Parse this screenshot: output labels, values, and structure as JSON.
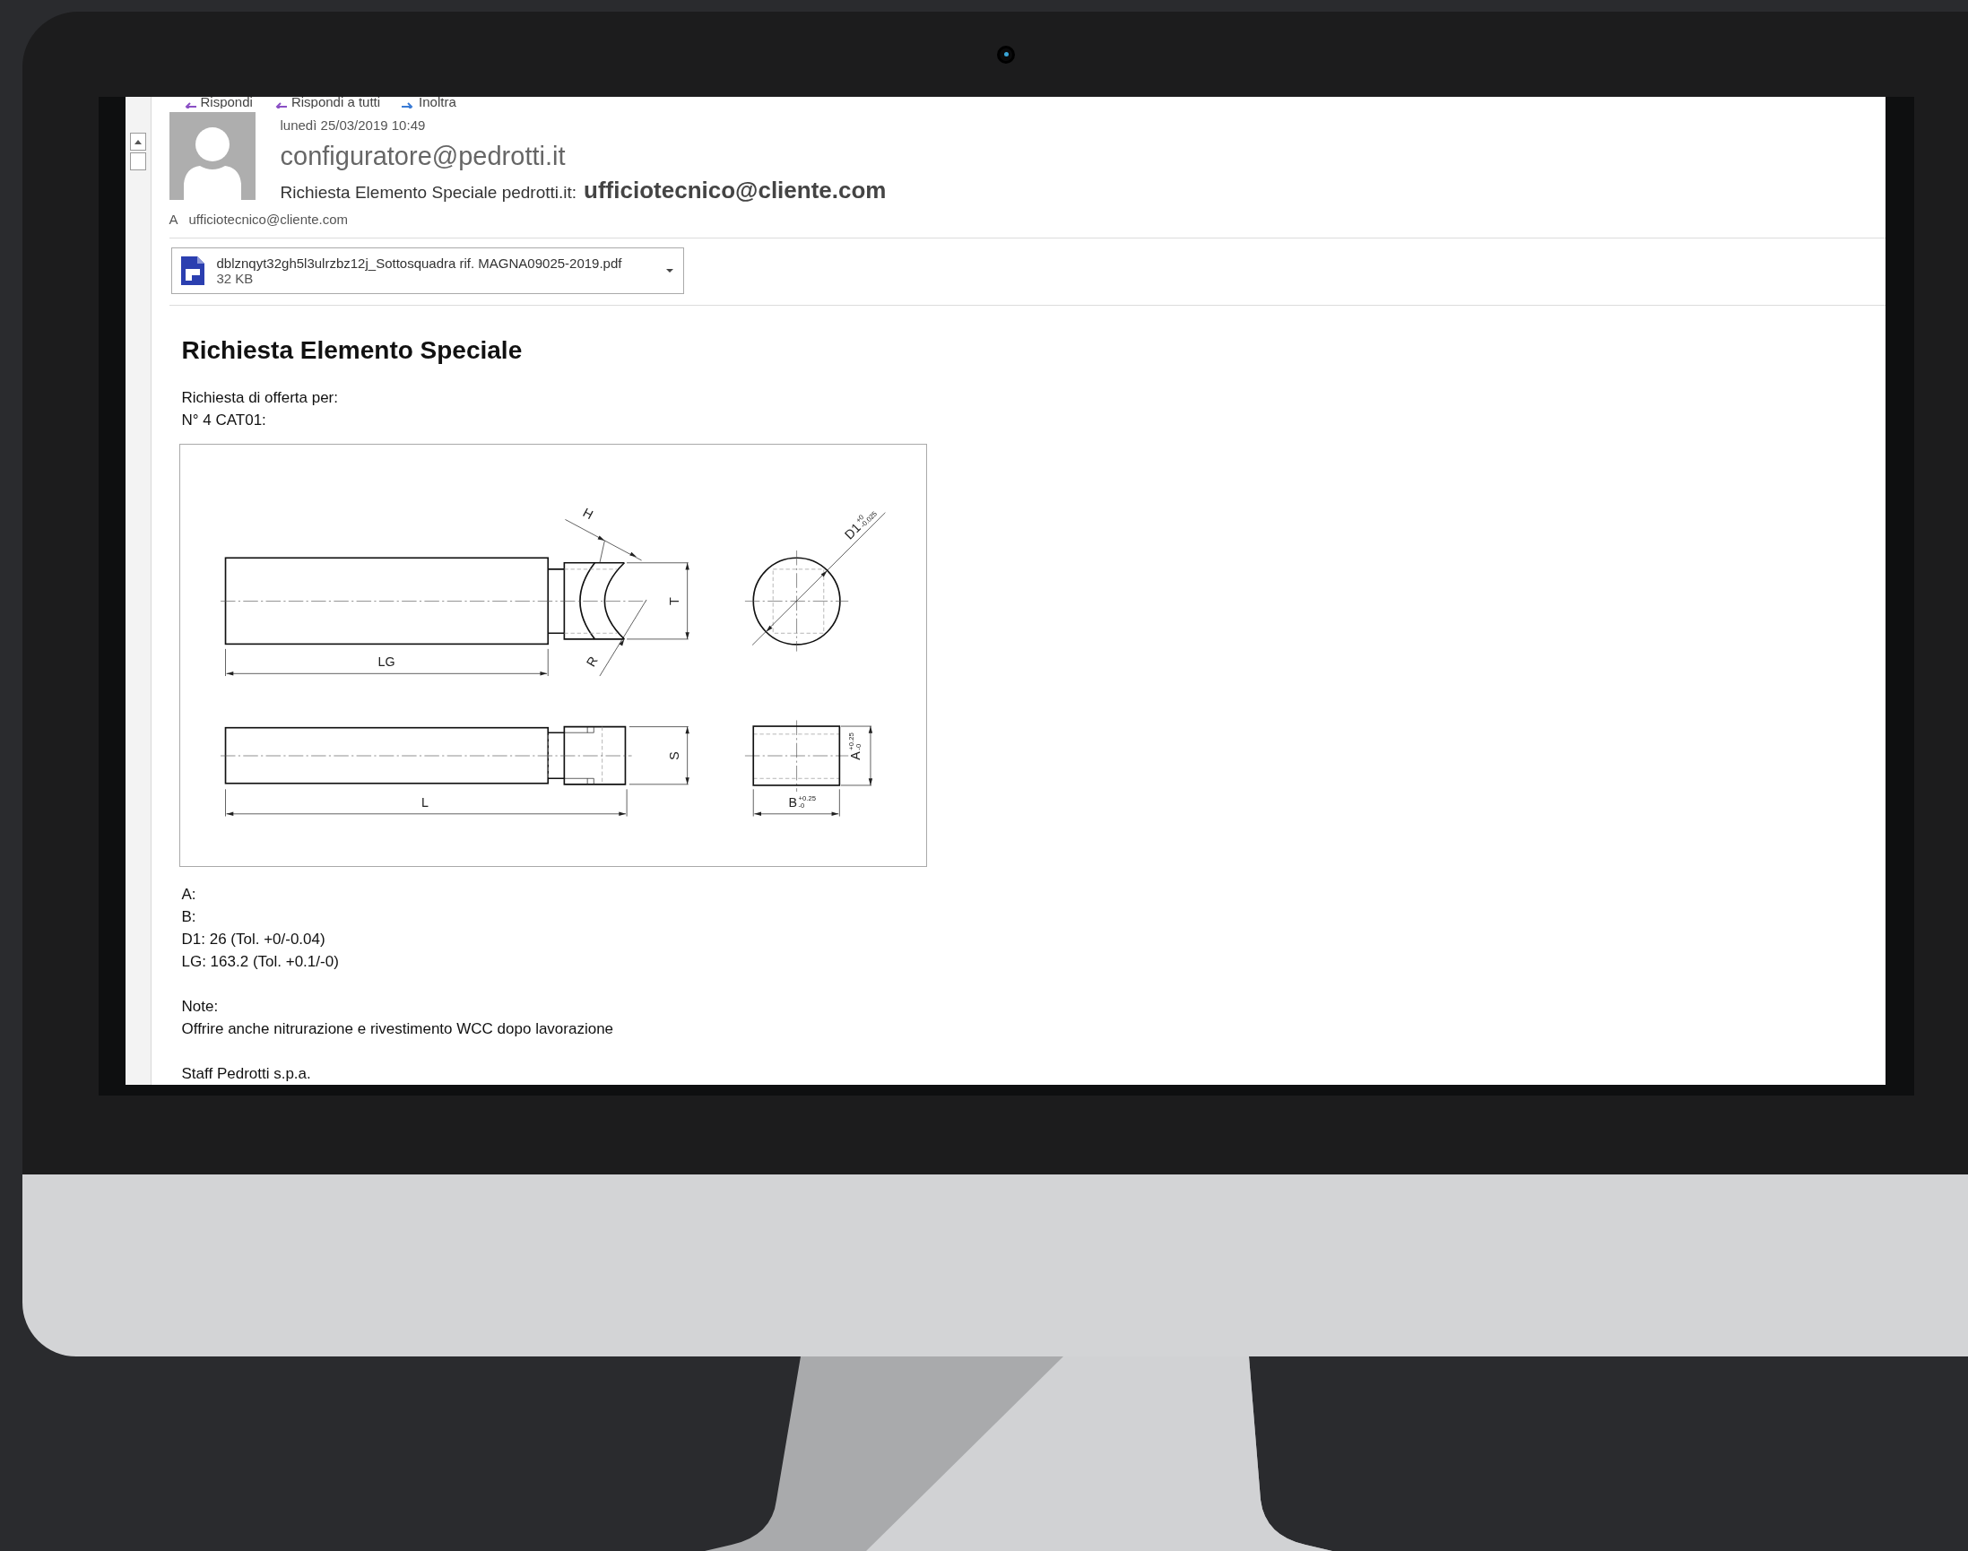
{
  "toolbar": [
    {
      "label": "Rispondi"
    },
    {
      "label": "Rispondi a tutti"
    },
    {
      "label": "Inoltra"
    }
  ],
  "message": {
    "date": "lunedì 25/03/2019 10:49",
    "sender": "configuratore@pedrotti.it",
    "subject": "Richiesta Elemento Speciale pedrotti.it:",
    "subject_address": "ufficiotecnico@cliente.com",
    "to_label": "A",
    "to": "ufficiotecnico@cliente.com"
  },
  "attachment": {
    "name": "dblznqyt32gh5l3ulrzbz12j_Sottosquadra  rif. MAGNA09025-2019.pdf",
    "size": "32 KB"
  },
  "body": {
    "title": "Richiesta Elemento Speciale",
    "intro": [
      "Richiesta di offerta per:",
      "N° 4 CAT01:"
    ],
    "figure_labels": [
      {
        "text": "H"
      },
      {
        "text": "T"
      },
      {
        "text": "R"
      },
      {
        "text": "LG"
      },
      {
        "text": "D1",
        "tolerance": [
          "+0",
          "-0.025"
        ]
      },
      {
        "text": "S"
      },
      {
        "text": "L"
      },
      {
        "text": "A",
        "tolerance": [
          "+0.25",
          "-0"
        ]
      },
      {
        "text": "B",
        "tolerance": [
          "+0.25",
          "-0"
        ]
      }
    ],
    "values": [
      "A:",
      "B:",
      "D1: 26 (Tol. +0/-0.04)",
      "LG: 163.2 (Tol. +0.1/-0)"
    ],
    "note_label": "Note:",
    "note": "Offrire anche nitrurazione e rivestimento WCC dopo lavorazione",
    "signature": "Staff Pedrotti s.p.a."
  }
}
